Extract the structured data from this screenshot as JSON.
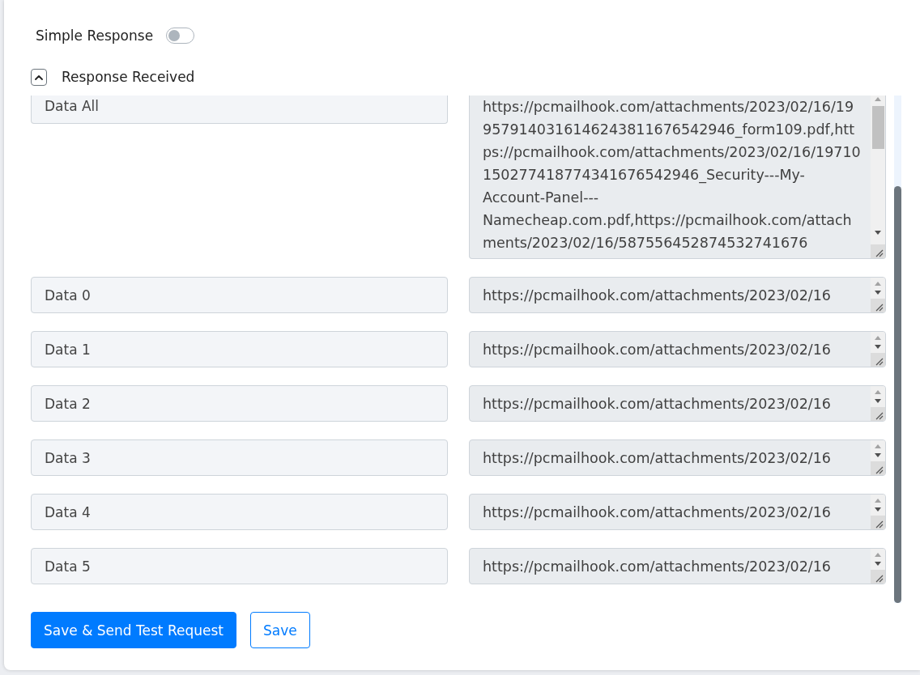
{
  "simple_response": {
    "label": "Simple Response",
    "on": false
  },
  "response_received": {
    "title": "Response Received",
    "expanded": true
  },
  "fields": [
    {
      "kind": "multiline",
      "key": "Data All",
      "value": "https://pcmailhook.com/attachments/2023/02/16/199579140316146243811676542946_form109.pdf,https://pcmailhook.com/attachments/2023/02/16/19710150277418774341676542946_Security---My-Account-Panel---Namecheap.com.pdf,https://pcmailhook.com/attachments/2023/02/16/587556452874532741676"
    },
    {
      "kind": "single",
      "key": "Data 0",
      "value": "https://pcmailhook.com/attachments/2023/02/16"
    },
    {
      "kind": "single",
      "key": "Data 1",
      "value": "https://pcmailhook.com/attachments/2023/02/16"
    },
    {
      "kind": "single",
      "key": "Data 2",
      "value": "https://pcmailhook.com/attachments/2023/02/16"
    },
    {
      "kind": "single",
      "key": "Data 3",
      "value": "https://pcmailhook.com/attachments/2023/02/16"
    },
    {
      "kind": "single",
      "key": "Data 4",
      "value": "https://pcmailhook.com/attachments/2023/02/16"
    },
    {
      "kind": "single",
      "key": "Data 5",
      "value": "https://pcmailhook.com/attachments/2023/02/16"
    }
  ],
  "buttons": [
    {
      "kind": "primary",
      "label": "Save & Send Test Request"
    },
    {
      "kind": "outline",
      "label": "Save"
    }
  ]
}
